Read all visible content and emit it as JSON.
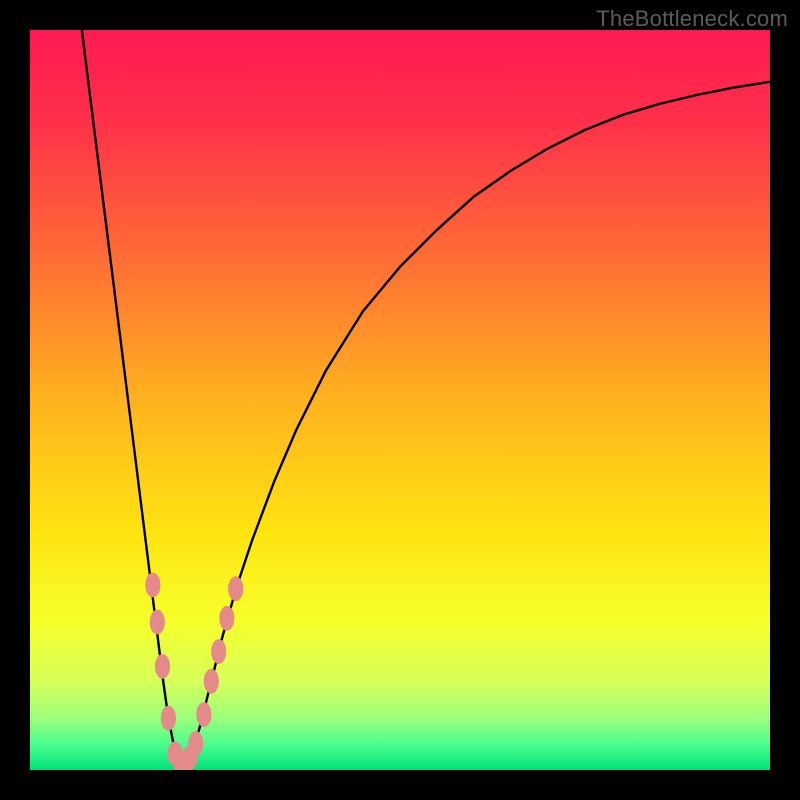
{
  "watermark": "TheBottleneck.com",
  "chart_data": {
    "type": "line",
    "title": "",
    "xlabel": "",
    "ylabel": "",
    "xlim": [
      0,
      100
    ],
    "ylim": [
      0,
      100
    ],
    "grid": false,
    "legend": false,
    "gradient_stops": [
      {
        "offset": 0.0,
        "color": "#ff1a53"
      },
      {
        "offset": 0.12,
        "color": "#ff2f4a"
      },
      {
        "offset": 0.3,
        "color": "#ff6a36"
      },
      {
        "offset": 0.5,
        "color": "#ffb21f"
      },
      {
        "offset": 0.68,
        "color": "#ffe411"
      },
      {
        "offset": 0.8,
        "color": "#f6ff2a"
      },
      {
        "offset": 0.88,
        "color": "#d8ff5a"
      },
      {
        "offset": 0.93,
        "color": "#9bff7a"
      },
      {
        "offset": 0.965,
        "color": "#4cff8f"
      },
      {
        "offset": 1.0,
        "color": "#00e07a"
      }
    ],
    "series": [
      {
        "name": "bottleneck-curve",
        "color": "#000000",
        "x": [
          7,
          8,
          9,
          10,
          11,
          12,
          13,
          14,
          15,
          16,
          17,
          18,
          18.7,
          19.4,
          20,
          20.6,
          21.3,
          22,
          23,
          24,
          25,
          26,
          28,
          30,
          33,
          36,
          40,
          45,
          50,
          55,
          60,
          65,
          70,
          75,
          80,
          85,
          90,
          95,
          100
        ],
        "y": [
          100,
          92,
          84,
          76,
          68,
          60,
          52,
          44,
          36,
          28,
          20,
          12,
          7,
          3.5,
          1.2,
          0.3,
          0.8,
          2.5,
          6,
          10,
          14,
          18,
          25,
          31,
          39,
          46,
          54,
          62,
          68,
          73,
          77.5,
          81,
          84,
          86.5,
          88.5,
          90,
          91.2,
          92.2,
          93
        ]
      }
    ],
    "markers": {
      "name": "data-dots",
      "color": "#e58a8a",
      "radius_px": 8,
      "points": [
        {
          "x": 16.6,
          "y": 25
        },
        {
          "x": 17.2,
          "y": 20
        },
        {
          "x": 17.9,
          "y": 14
        },
        {
          "x": 18.7,
          "y": 7
        },
        {
          "x": 19.6,
          "y": 2.2
        },
        {
          "x": 20.5,
          "y": 0.4
        },
        {
          "x": 21.0,
          "y": 0.6
        },
        {
          "x": 21.6,
          "y": 1.7
        },
        {
          "x": 22.4,
          "y": 3.6
        },
        {
          "x": 23.5,
          "y": 7.5
        },
        {
          "x": 24.5,
          "y": 12
        },
        {
          "x": 25.5,
          "y": 16
        },
        {
          "x": 26.6,
          "y": 20.5
        },
        {
          "x": 27.8,
          "y": 24.5
        }
      ]
    }
  }
}
